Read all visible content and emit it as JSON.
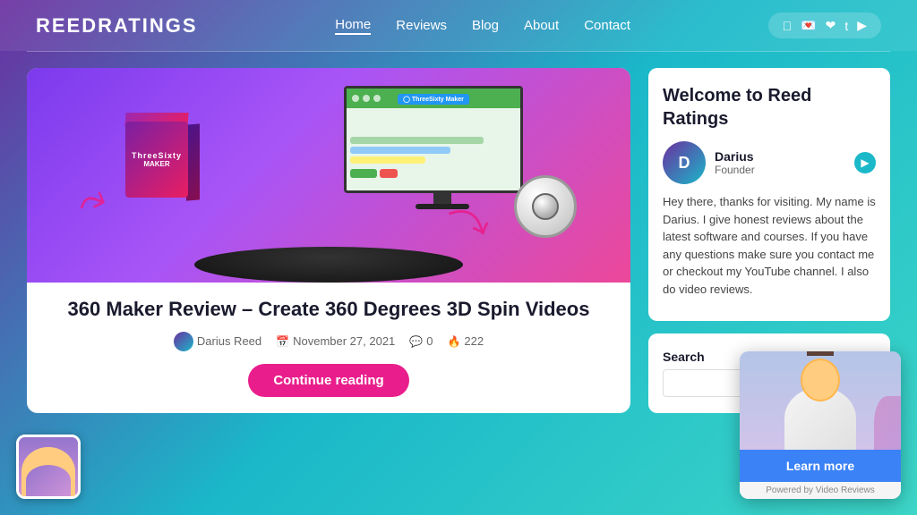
{
  "header": {
    "logo": "ReedRatings",
    "nav": {
      "items": [
        {
          "label": "Home",
          "active": true
        },
        {
          "label": "Reviews",
          "active": false
        },
        {
          "label": "Blog",
          "active": false
        },
        {
          "label": "About",
          "active": false
        },
        {
          "label": "Contact",
          "active": false
        }
      ]
    },
    "social": [
      "f",
      "t",
      "p",
      "t",
      "yt"
    ]
  },
  "article": {
    "title": "360 Maker Review – Create 360 Degrees 3D Spin Videos",
    "image_alt": "360 Maker product image",
    "author": "Darius Reed",
    "date": "November 27, 2021",
    "comments": "0",
    "views": "222",
    "continue_btn": "Continue reading"
  },
  "sidebar": {
    "welcome_title": "Welcome to Reed Ratings",
    "author_name": "Darius",
    "author_role": "Founder",
    "description": "Hey there, thanks for visiting. My name is Darius. I give honest reviews about the latest software and courses. If you have any questions make sure you contact me or checkout my YouTube channel. I also do video reviews.",
    "search_label": "Search",
    "search_placeholder": ""
  },
  "video_popup": {
    "learn_more_label": "Learn more",
    "powered_by": "Powered by Video Reviews"
  }
}
